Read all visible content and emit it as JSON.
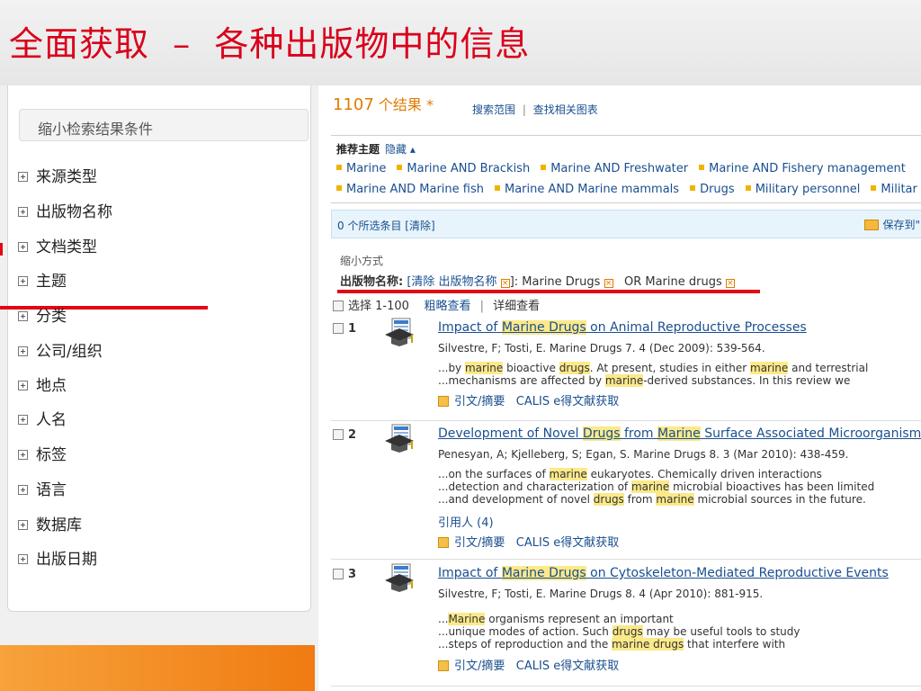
{
  "slide": {
    "title": "全面获取  –  各种出版物中的信息"
  },
  "filters": {
    "header": "缩小检索结果条件",
    "items": [
      "来源类型",
      "出版物名称",
      "文档类型",
      "主题",
      "分类",
      "公司/组织",
      "地点",
      "人名",
      "标签",
      "语言",
      "数据库",
      "出版日期"
    ]
  },
  "results": {
    "count": "1107",
    "count_suffix": " 个结果 *",
    "scope": "搜索范围",
    "separator": "|",
    "related_charts": "查找相关图表",
    "topics_label": "推荐主题",
    "topics_hide": "隐藏 ▴",
    "topics_row1": [
      "Marine",
      "Marine AND Brackish",
      "Marine AND Freshwater",
      "Marine AND Fishery management"
    ],
    "topics_row2": [
      "Marine AND Marine fish",
      "Marine AND Marine mammals",
      "Drugs",
      "Military personnel",
      "Militar"
    ],
    "selected_text": "0 个所选条目 [清除]",
    "save_to": "保存到\"",
    "refine_label": "缩小方式",
    "refine_field": "出版物名称:",
    "refine_clear": "[清除 出版物名称",
    "refine_clear_end": "]: Marine Drugs",
    "refine_or": "OR Marine drugs",
    "select_range": "选择 1-100",
    "brief_view": "粗略查看",
    "detail_view": "详细查看",
    "records": [
      {
        "num": "1",
        "title_parts": [
          "Impact of ",
          "Marine Drugs",
          " on Animal Reproductive Processes"
        ],
        "meta": "Silvestre, F; Tosti, E. Marine Drugs 7. 4  (Dec 2009): 539-564.",
        "snippets": [
          [
            "...by ",
            "marine",
            " bioactive ",
            "drugs",
            ". At present, studies in either ",
            "marine",
            " and terrestrial"
          ],
          [
            "...mechanisms are affected by ",
            "marine",
            "-derived substances. In this review we"
          ]
        ],
        "cited_by": "",
        "abstract_link": "引文/摘要",
        "calis_link": "CALIS e得文献获取"
      },
      {
        "num": "2",
        "title_parts": [
          "Development of Novel ",
          "Drugs",
          " from ",
          "Marine",
          " Surface Associated Microorganisms"
        ],
        "meta": "Penesyan, A; Kjelleberg, S; Egan, S. Marine Drugs 8. 3  (Mar 2010): 438-459.",
        "snippets": [
          [
            "...on the surfaces of ",
            "marine",
            " eukaryotes. Chemically driven interactions"
          ],
          [
            "...detection and characterization of ",
            "marine",
            " microbial bioactives has been limited"
          ],
          [
            "...and development of novel ",
            "drugs",
            " from ",
            "marine",
            " microbial sources in the future."
          ]
        ],
        "cited_by": "引用人 (4)",
        "abstract_link": "引文/摘要",
        "calis_link": "CALIS e得文献获取"
      },
      {
        "num": "3",
        "title_parts": [
          "Impact of ",
          "Marine Drugs",
          " on Cytoskeleton-Mediated Reproductive Events"
        ],
        "meta": "Silvestre, F; Tosti, E. Marine Drugs 8. 4  (Apr 2010): 881-915.",
        "snippets": [
          [
            "...",
            "Marine",
            " organisms represent an important"
          ],
          [
            "...unique modes of action. Such ",
            "drugs",
            " may be useful tools to study"
          ],
          [
            "...steps of reproduction and the ",
            "marine drugs",
            " that interfere with"
          ]
        ],
        "cited_by": "",
        "abstract_link": "引文/摘要",
        "calis_link": "CALIS e得文献获取"
      }
    ]
  },
  "colors": {
    "title_red": "#d9001b",
    "highlight": "#fbe98a",
    "link_blue": "#1a4f8f",
    "count_orange": "#e07b00",
    "annotation_red": "#e30613"
  }
}
